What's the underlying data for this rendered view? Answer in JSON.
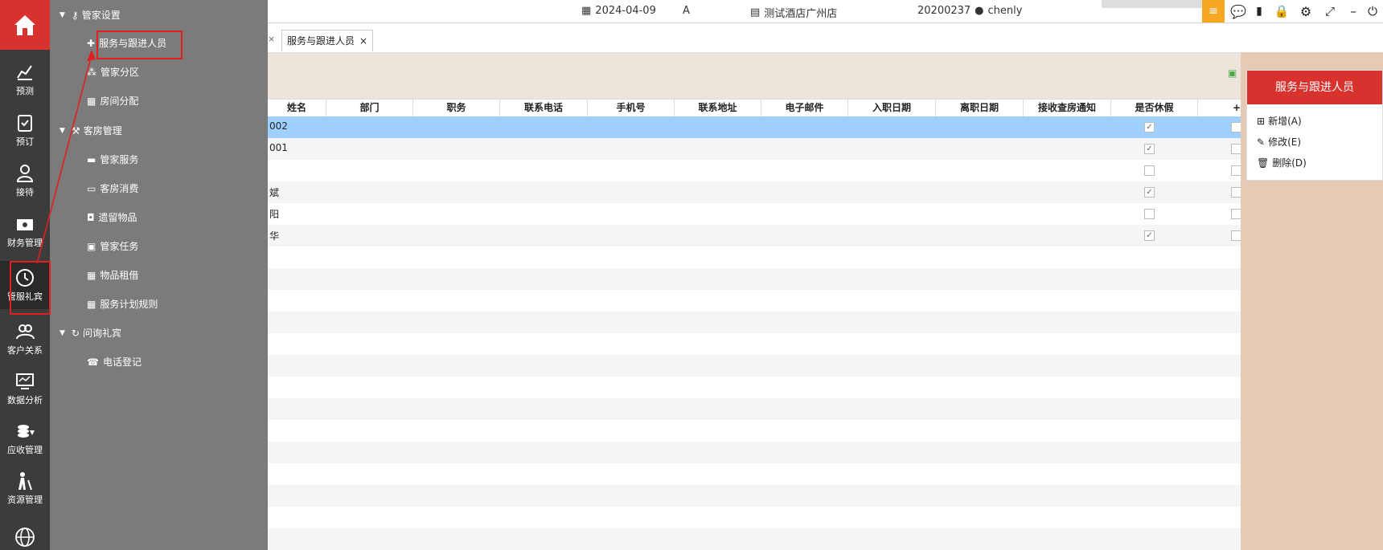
{
  "leftnav": {
    "items": [
      {
        "label": "预测",
        "icon": "chart-icon"
      },
      {
        "label": "预订",
        "icon": "clipboard-icon"
      },
      {
        "label": "接待",
        "icon": "person-icon"
      },
      {
        "label": "财务管理",
        "icon": "money-icon"
      },
      {
        "label": "管服礼宾",
        "icon": "clock-icon"
      },
      {
        "label": "客户关系",
        "icon": "people-icon"
      },
      {
        "label": "数据分析",
        "icon": "monitor-icon"
      },
      {
        "label": "应收管理",
        "icon": "coins-icon"
      },
      {
        "label": "资源管理",
        "icon": "walker-icon"
      }
    ]
  },
  "submenu": {
    "groups": [
      {
        "label": "管家设置",
        "items": [
          "服务与跟进人员",
          "管家分区",
          "房间分配"
        ]
      },
      {
        "label": "客房管理",
        "items": [
          "管家服务",
          "客房消费",
          "遗留物品",
          "管家任务",
          "物品租借",
          "服务计划规则"
        ]
      },
      {
        "label": "问询礼宾",
        "items": [
          "电话登记"
        ]
      }
    ]
  },
  "topbar": {
    "date": "2024-04-09",
    "shift": "A",
    "hotel": "测试酒店广州店",
    "user_id": "20200237",
    "user": "chenly"
  },
  "tabs": {
    "active": "服务与跟进人员"
  },
  "grid": {
    "columns": [
      "姓名",
      "部门",
      "职务",
      "联系电话",
      "手机号",
      "联系地址",
      "电子邮件",
      "入职日期",
      "离职日期",
      "接收查房通知",
      "是否休假"
    ],
    "rows": [
      {
        "name": "002",
        "notify": true,
        "vacation": false
      },
      {
        "name": "001",
        "notify": true,
        "vacation": false
      },
      {
        "name": "",
        "notify": false,
        "vacation": false
      },
      {
        "name": "斌",
        "notify": true,
        "vacation": false
      },
      {
        "name": "阳",
        "notify": false,
        "vacation": false
      },
      {
        "name": "华",
        "notify": true,
        "vacation": false
      }
    ]
  },
  "right_panel": {
    "title": "服务与跟进人员",
    "add": "新增(A)",
    "edit": "修改(E)",
    "delete": "删除(D)"
  }
}
